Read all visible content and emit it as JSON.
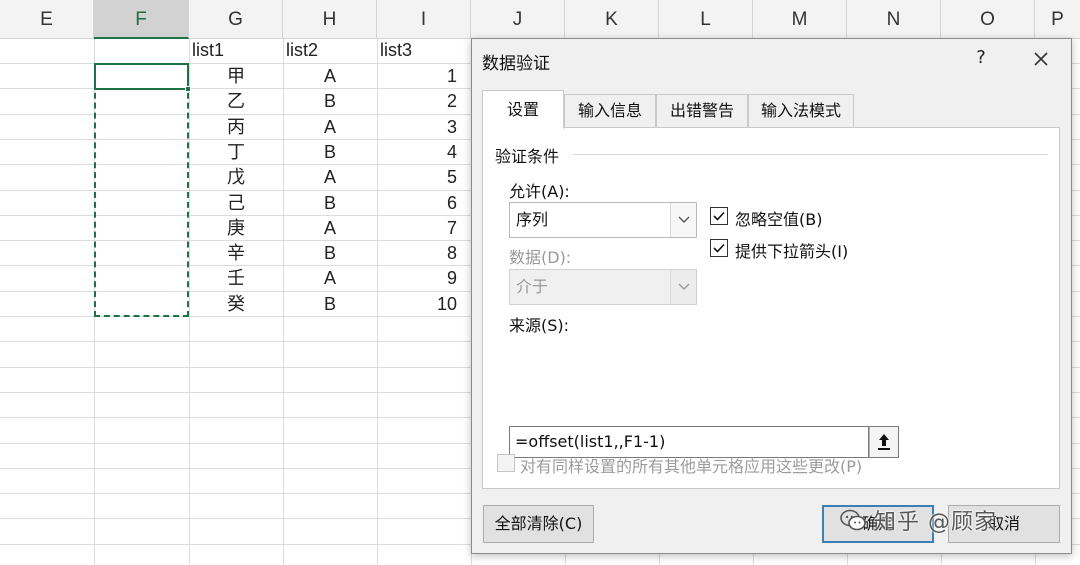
{
  "sheet": {
    "columns": [
      "E",
      "F",
      "G",
      "H",
      "I",
      "J",
      "K",
      "L",
      "M",
      "N",
      "O",
      "P"
    ],
    "selected_column": "F",
    "headers": {
      "g": "list1",
      "h": "list2",
      "i": "list3"
    },
    "list1": [
      "甲",
      "乙",
      "丙",
      "丁",
      "戊",
      "己",
      "庚",
      "辛",
      "壬",
      "癸"
    ],
    "list2": [
      "A",
      "B",
      "A",
      "B",
      "A",
      "B",
      "A",
      "B",
      "A",
      "B"
    ],
    "list3": [
      "1",
      "2",
      "3",
      "4",
      "5",
      "6",
      "7",
      "8",
      "9",
      "10"
    ]
  },
  "dialog": {
    "title": "数据验证",
    "help": "?",
    "close_icon": "close-icon",
    "tabs": [
      "设置",
      "输入信息",
      "出错警告",
      "输入法模式"
    ],
    "active_tab": "设置",
    "group_title": "验证条件",
    "allow_label": "允许(A):",
    "allow_value": "序列",
    "data_label": "数据(D):",
    "data_value": "介于",
    "ignore_blank": {
      "label": "忽略空值(B)",
      "checked": true
    },
    "in_cell_dropdown": {
      "label": "提供下拉箭头(I)",
      "checked": true
    },
    "source_label": "来源(S):",
    "source_value": "=offset(list1,,F1-1)",
    "ref_button_icon": "collapse-dialog-icon",
    "apply_all": {
      "label": "对有同样设置的所有其他单元格应用这些更改(P)",
      "checked": false
    },
    "clear_all_button": "全部清除(C)",
    "ok_button": "确定",
    "cancel_button": "取消"
  },
  "watermark": {
    "text": "知乎 @顾家",
    "icon": "wechat-logo-icon"
  },
  "colors": {
    "excel_green": "#217346",
    "dialog_bg": "#f0f0f0",
    "ok_border": "#3c7fb1"
  }
}
